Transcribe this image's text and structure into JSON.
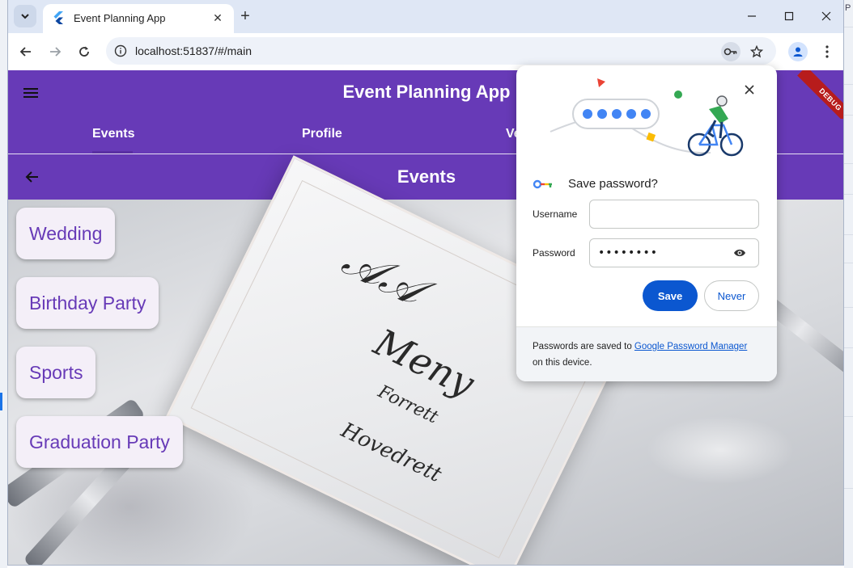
{
  "browser": {
    "tab_title": "Event Planning App",
    "new_tab_symbol": "+",
    "tab_close_symbol": "✕",
    "url": "localhost:51837/#/main"
  },
  "desktop": {
    "edge_letter": "P"
  },
  "app": {
    "title": "Event Planning App",
    "tabs": [
      {
        "label": "Events"
      },
      {
        "label": "Profile"
      },
      {
        "label": "Ve"
      }
    ],
    "subtitle": "Events",
    "debug_label": "DEBUG",
    "events": [
      {
        "label": "Wedding"
      },
      {
        "label": "Birthday Party"
      },
      {
        "label": "Sports"
      },
      {
        "label": "Graduation Party"
      }
    ]
  },
  "password_bubble": {
    "heading": "Save password?",
    "username_label": "Username",
    "username_value": "",
    "password_label": "Password",
    "password_value": "••••••••",
    "save_label": "Save",
    "never_label": "Never",
    "footer_prefix": "Passwords are saved to ",
    "footer_link": "Google Password Manager",
    "footer_suffix": "on this device."
  },
  "colors": {
    "app_primary": "#673ab7",
    "card_background": "#f4eff8",
    "save_button": "#0b57d0",
    "tab_strip": "#dfe7f5",
    "debug_ribbon": "#b71c1c"
  },
  "icons": {
    "tab_search": "chevron-down-icon",
    "back": "arrow-left-icon",
    "forward": "arrow-right-icon",
    "reload": "reload-icon",
    "site_info": "info-icon",
    "password_key": "key-icon",
    "bookmark": "star-icon",
    "profile": "person-icon",
    "menu": "kebab-icon",
    "app_menu": "hamburger-icon",
    "app_back": "arrow-left-icon",
    "reveal_password": "eye-icon"
  }
}
